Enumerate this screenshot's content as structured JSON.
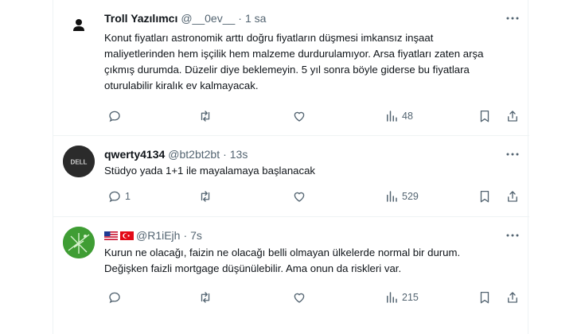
{
  "tweets": [
    {
      "name": "Troll Yazılımcı",
      "handle": "@__0ev__",
      "separator": "·",
      "time": "1 sa",
      "text": "Konut fiyatları astronomik arttı doğru fiyatların düşmesi imkansız inşaat maliyetlerinden hem işçilik hem malzeme durdurulamıyor. Arsa fiyatları zaten arşa çıkmış durumda. Düzelir diye beklemeyin. 5 yıl sonra böyle giderse bu fiyatlara oturulabilir kiralık ev kalmayacak.",
      "reply_count": "",
      "retweet_count": "",
      "like_count": "",
      "views": "48",
      "avatar_icon": "person-silhouette-icon"
    },
    {
      "name": "qwerty4134",
      "handle": "@bt2bt2bt",
      "separator": "·",
      "time": "13s",
      "text": "Stüdyo yada 1+1 ile mayalamaya başlanacak",
      "reply_count": "1",
      "retweet_count": "",
      "like_count": "",
      "views": "529",
      "avatar_icon": "dell-logo-icon",
      "avatar_text": "DELL"
    },
    {
      "name": "",
      "flags": [
        "us-flag-icon",
        "tr-flag-icon"
      ],
      "handle": "@R1iEjh",
      "separator": "·",
      "time": "7s",
      "text": "Kurun ne olacağı, faizin ne olacağı belli olmayan ülkelerde normal bir durum. Değişken faizli mortgage düşünülebilir. Ama onun da riskleri var.",
      "reply_count": "",
      "retweet_count": "",
      "like_count": "",
      "views": "215",
      "avatar_icon": "green-abstract-avatar-icon"
    }
  ],
  "colors": {
    "text": "#0f1419",
    "muted": "#536471",
    "border": "#eff3f4"
  }
}
